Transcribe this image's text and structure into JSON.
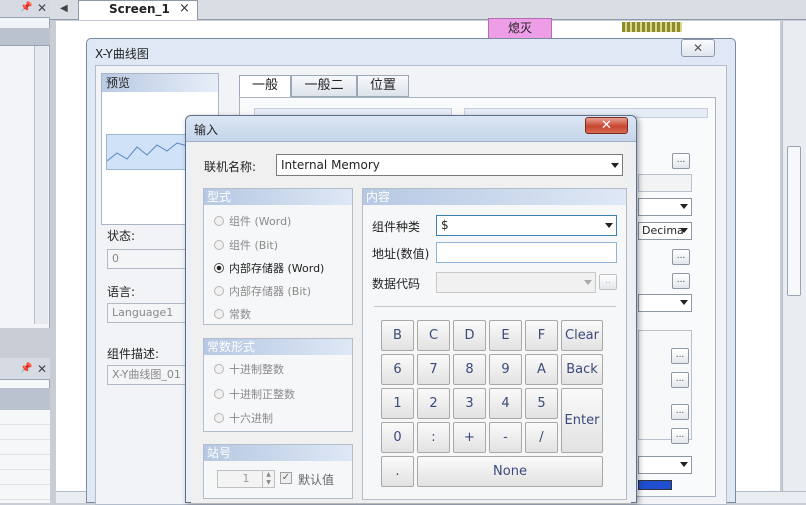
{
  "ide": {
    "doc_tab": "Screen_1",
    "pink_buttons": [
      "熄灭",
      "熄灭"
    ]
  },
  "xy_dialog": {
    "title": "X-Y曲线图",
    "preview_label": "预览",
    "tabs": [
      "一般",
      "一般二",
      "位置"
    ],
    "status_label": "状态:",
    "status_value": "0",
    "language_label": "语言:",
    "language_value": "Language1",
    "component_desc_label": "组件描述:",
    "component_desc_value": "X-Y曲线图_01",
    "right_combo_value": "Decima"
  },
  "input_dialog": {
    "title": "输入",
    "device_label": "联机名称:",
    "device_value": "Internal Memory",
    "type_group": {
      "header": "型式",
      "options": [
        "组件 (Word)",
        "组件 (Bit)",
        "内部存储器 (Word)",
        "内部存储器 (Bit)",
        "常数"
      ],
      "selected": "内部存储器 (Word)"
    },
    "const_group": {
      "header": "常数形式",
      "options": [
        "十进制整数",
        "十进制正整数",
        "十六进制"
      ]
    },
    "station_group": {
      "header": "站号",
      "value": "1",
      "default_label": "默认值"
    },
    "content_group": {
      "header": "内容",
      "component_type_label": "组件种类",
      "component_type_value": "$",
      "address_label": "地址(数值)",
      "address_value": "",
      "data_code_label": "数据代码",
      "data_code_value": ""
    },
    "keypad": {
      "row1": [
        "B",
        "C",
        "D",
        "E",
        "F",
        "Clear"
      ],
      "row2": [
        "6",
        "7",
        "8",
        "9",
        "A",
        "Back"
      ],
      "row3": [
        "1",
        "2",
        "3",
        "4",
        "5"
      ],
      "row4": [
        "0",
        ":",
        "+",
        "-",
        "/"
      ],
      "enter": "Enter",
      "dot": ".",
      "none": "None"
    }
  }
}
